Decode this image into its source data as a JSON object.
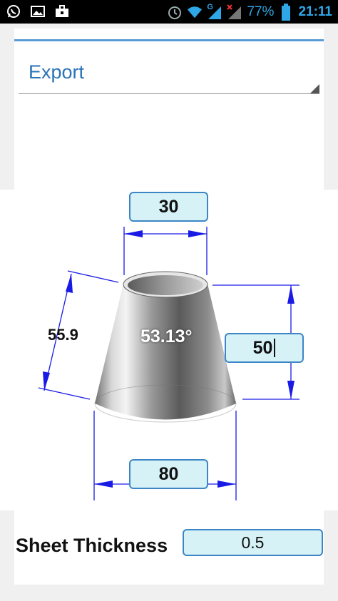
{
  "status_bar": {
    "battery_percent": "77%",
    "time": "21:11",
    "network_label": "G",
    "icons": [
      "whatsapp-icon",
      "gallery-icon",
      "briefcase-icon",
      "alarm-icon",
      "wifi-icon",
      "signal-icon",
      "signal-no-data-icon",
      "battery-icon"
    ]
  },
  "export": {
    "selected": "Export"
  },
  "drawing": {
    "top_diameter": "30",
    "bottom_diameter": "80",
    "height": "50",
    "slant_length": "55.9",
    "angle": "53.13°"
  },
  "sheet_thickness": {
    "label": "Sheet Thickness",
    "value": "0.5"
  },
  "colors": {
    "accent": "#2a73b8",
    "input_bg": "#d6f2f7",
    "input_border": "#3d86c6",
    "dimension_line": "#1a1ae6"
  }
}
